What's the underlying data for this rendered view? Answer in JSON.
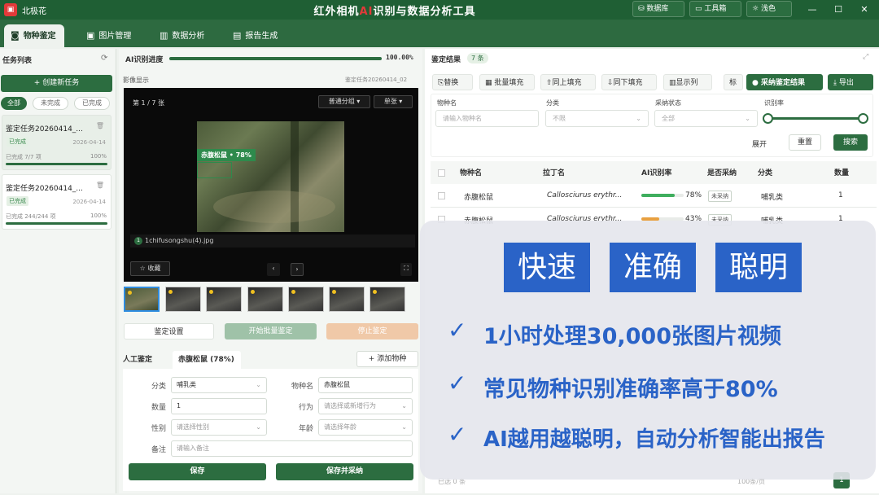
{
  "app": {
    "icon_label": "▣",
    "name": "北极花",
    "title": "红外相机AI识别与数据分析工具",
    "title_prefix": "红外相机",
    "title_ai": "AI",
    "title_suffix": "识别与数据分析工具",
    "buttons": {
      "database": "数据库",
      "toolbox": "工具箱",
      "theme": "浅色"
    },
    "window_controls": {
      "minimize": "—",
      "maximize": "☐",
      "close": "✕"
    }
  },
  "tabs": [
    {
      "label": "物种鉴定",
      "icon": "image-search-icon"
    },
    {
      "label": "图片管理",
      "icon": "images-icon"
    },
    {
      "label": "数据分析",
      "icon": "bar-chart-icon"
    },
    {
      "label": "报告生成",
      "icon": "report-icon"
    }
  ],
  "task_list": {
    "title": "任务列表",
    "refresh_icon": "⟳",
    "create_button": "+ 创建新任务",
    "filters": [
      "全部",
      "未完成",
      "已完成"
    ],
    "tasks": [
      {
        "name": "鉴定任务20260414_...",
        "status": "已完成",
        "date": "2026-04-14",
        "progress_text": "已完成 7/7 项",
        "percent": "100%"
      },
      {
        "name": "鉴定任务20260414_...",
        "status": "已完成",
        "date": "2026-04-14",
        "progress_text": "已完成 244/244 项",
        "percent": "100%"
      }
    ]
  },
  "ai_progress": {
    "label": "AI识别进度",
    "value": "100.00%",
    "fraction": 1.0
  },
  "viewer": {
    "section_label": "影像显示",
    "task_ref": "鉴定任务20260414_02",
    "page_counter": "第 1 / 7 张",
    "group_mode": "普通分组 ▾",
    "view_mode": "单张 ▾",
    "detection_label": "赤腹松鼠 • 78%",
    "file_index": "1",
    "file_name": "1chifusongshu(4).jpg",
    "favorite_button": "☆ 收藏",
    "prev": "‹",
    "next": "›",
    "fullscreen": "⛶"
  },
  "action_buttons": {
    "settings": "鉴定设置",
    "start_batch": "开始批量鉴定",
    "stop": "停止鉴定"
  },
  "annotation": {
    "tab_manual": "人工鉴定",
    "tab_species": "赤腹松鼠 (78%)",
    "add_species": "+ 添加物种",
    "fields": {
      "category_label": "分类",
      "category_value": "哺乳类",
      "species_label": "物种名",
      "species_value": "赤腹松鼠",
      "count_label": "数量",
      "count_value": "1",
      "behavior_label": "行为",
      "behavior_placeholder": "请选择或新增行为",
      "sex_label": "性别",
      "sex_placeholder": "请选择性别",
      "age_label": "年龄",
      "age_placeholder": "请选择年龄",
      "note_label": "备注",
      "note_placeholder": "请输入备注"
    },
    "save": "保存",
    "save_adopt": "保存并采纳"
  },
  "results": {
    "title": "鉴定结果",
    "count_badge": "7 条",
    "toolbar": [
      "替换",
      "批量填充",
      "同上填充",
      "同下填充",
      "显示列",
      "标"
    ],
    "adopt_button": "采纳鉴定结果",
    "export_button": "导出",
    "filters": {
      "species_label": "物种名",
      "species_placeholder": "请输入物种名",
      "category_label": "分类",
      "category_value": "不限",
      "adopt_label": "采纳状态",
      "adopt_value": "全部",
      "rate_label": "识别率",
      "expand": "展开",
      "reset": "重置",
      "search": "搜索"
    },
    "columns": [
      "物种名",
      "拉丁名",
      "AI识别率",
      "是否采纳",
      "分类",
      "数量"
    ],
    "rows": [
      {
        "species": "赤腹松鼠",
        "latin": "Callosciurus erythr...",
        "rate": "78%",
        "rate_value": 78,
        "adopted": "未采纳",
        "category": "哺乳类",
        "count": "1"
      },
      {
        "species": "赤腹松鼠",
        "latin": "Callosciurus erythr...",
        "rate": "43%",
        "rate_value": 43,
        "adopted": "未采纳",
        "category": "哺乳类",
        "count": "1"
      }
    ],
    "footer": {
      "selected": "已选 0 条",
      "page_size": "100条/页",
      "page": "1"
    }
  },
  "promo": {
    "keywords": [
      "快速",
      "准确",
      "聪明"
    ],
    "claims": [
      "1小时处理30,000张图片视频",
      "常见物种识别准确率高于80%",
      "AI越用越聪明，自动分析智能出报告"
    ],
    "check": "✓"
  },
  "colors": {
    "brand": "#1f5f34",
    "accent": "#2c6d40",
    "promo_blue": "#2a63c7",
    "ai_red": "#e23a3a",
    "stop": "#f0c9a8"
  }
}
